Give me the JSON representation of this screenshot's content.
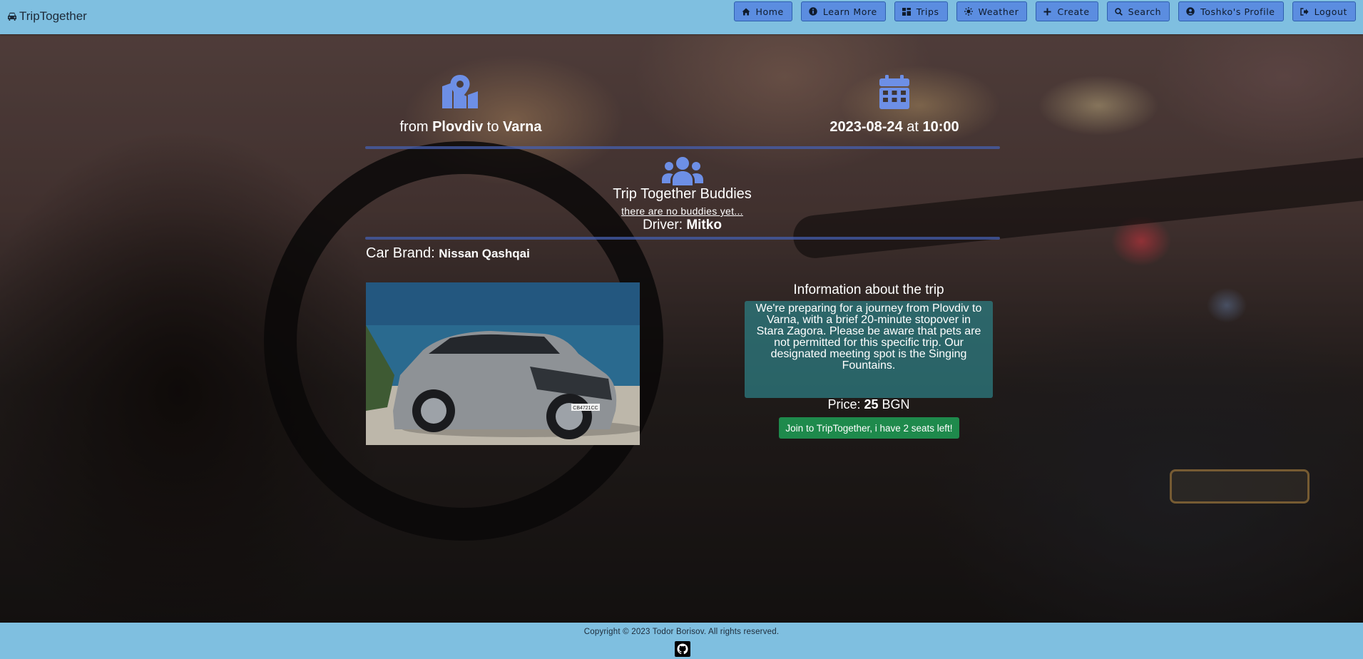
{
  "app": {
    "brand": "TripTogether"
  },
  "nav": [
    {
      "label": "Home",
      "icon": "home-icon"
    },
    {
      "label": "Learn More",
      "icon": "info-icon"
    },
    {
      "label": "Trips",
      "icon": "grid-icon"
    },
    {
      "label": "Weather",
      "icon": "sun-icon"
    },
    {
      "label": "Create",
      "icon": "plus-icon"
    },
    {
      "label": "Search",
      "icon": "search-icon"
    },
    {
      "label": "Toshko's Profile",
      "icon": "user-circle-icon"
    },
    {
      "label": "Logout",
      "icon": "logout-icon"
    }
  ],
  "trip": {
    "from_prefix": "from",
    "from": "Plovdiv",
    "to_word": "to",
    "to": "Varna",
    "date": "2023-08-24",
    "at_word": "at",
    "time": "10:00"
  },
  "buddies": {
    "title": "Trip Together Buddies",
    "empty_text": "there are no buddies yet..."
  },
  "driver": {
    "label": "Driver:",
    "name": "Mitko"
  },
  "car": {
    "label": "Car Brand:",
    "brand": "Nissan Qashqai",
    "plate": "CB4721CC"
  },
  "info": {
    "title": "Information about the trip",
    "description": "We're preparing for a journey from Plovdiv to Varna, with a brief 20-minute stopover in Stara Zagora. Please be aware that pets are not permitted for this specific trip. Our designated meeting spot is the Singing Fountains."
  },
  "price": {
    "label": "Price:",
    "amount": "25",
    "currency": "BGN"
  },
  "join_button": {
    "label": "Join to TripTogether, i have 2 seats left!"
  },
  "footer": {
    "copyright": "Copyright © 2023 Todor Borisov. All rights reserved."
  },
  "colors": {
    "header_bg": "#7fbfe0",
    "nav_button": "#5b8de0",
    "icon_blue": "#6d8fe6",
    "info_box": "#2d787d",
    "join_button": "#1e8a4c"
  }
}
